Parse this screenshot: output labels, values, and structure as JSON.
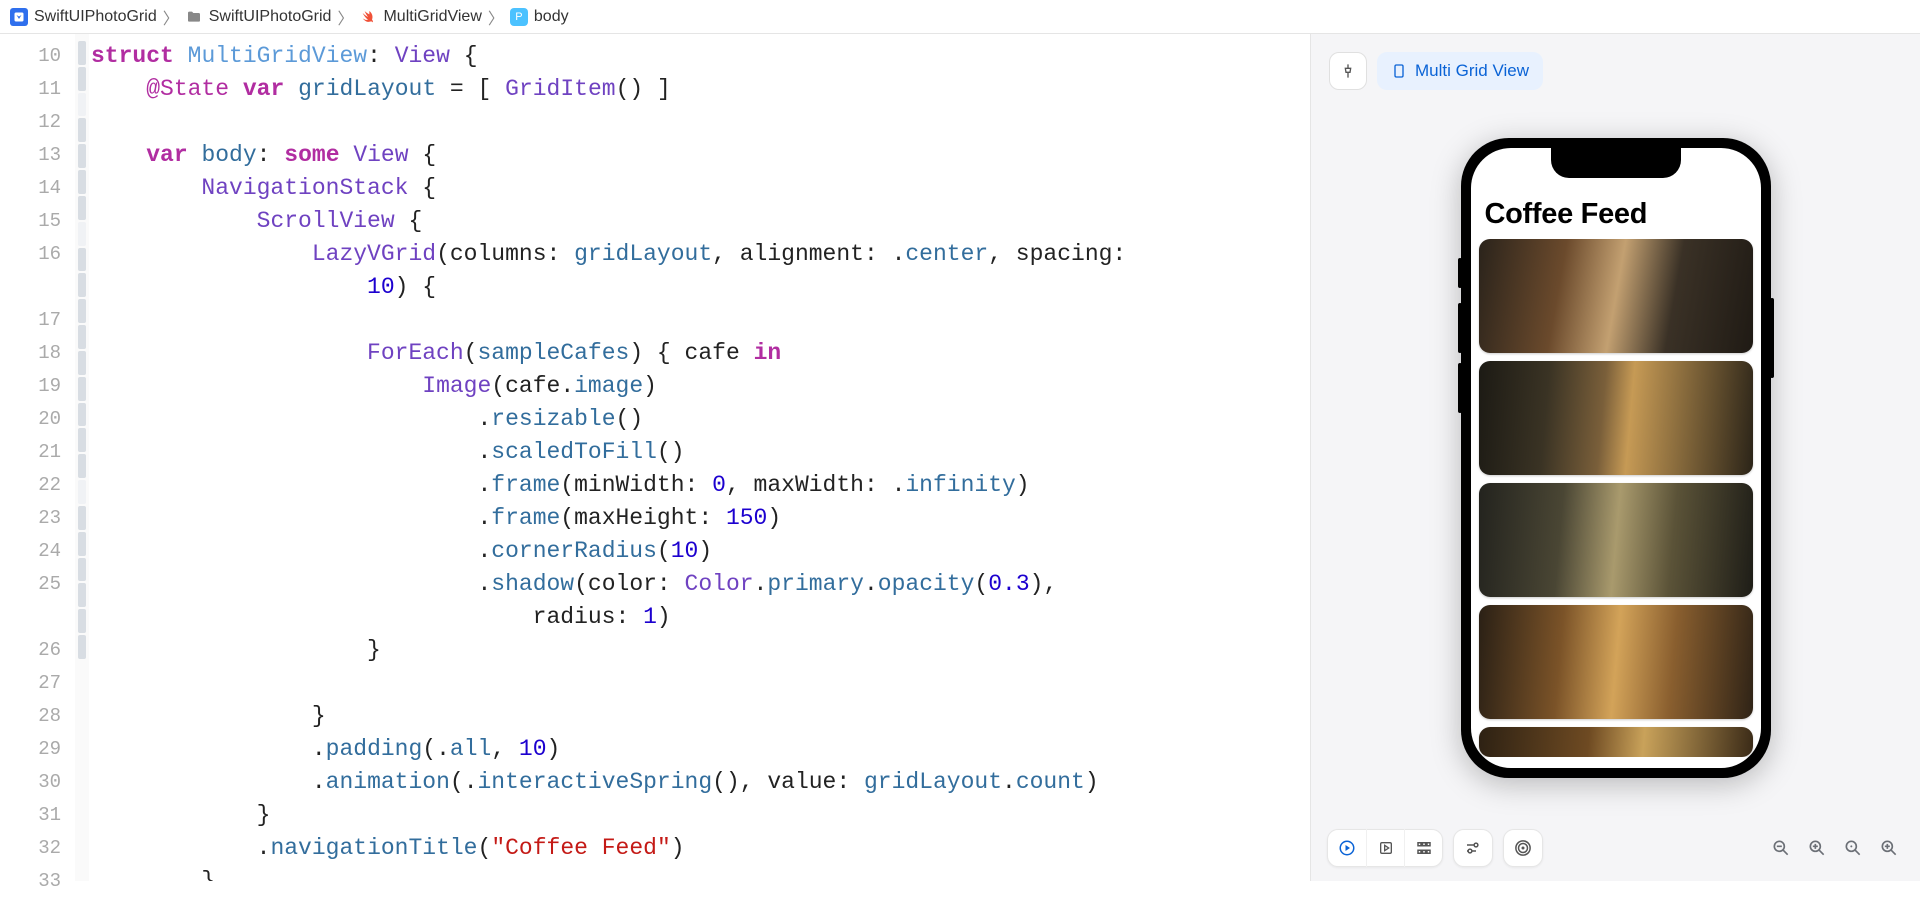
{
  "breadcrumb": {
    "project": "SwiftUIPhotoGrid",
    "folder": "SwiftUIPhotoGrid",
    "file": "MultiGridView",
    "symbol": "body"
  },
  "gutter": {
    "start": 10,
    "end": 33
  },
  "code": {
    "l10": {
      "kw_struct": "struct",
      "name": "MultiGridView",
      "colon": ":",
      "type": "View",
      "ob": "{"
    },
    "l11": {
      "at": "@State",
      "kw_var": "var",
      "name": "gridLayout",
      "eq": " = [ ",
      "item": "GridItem",
      "tail": "() ]"
    },
    "l13": {
      "kw_var": "var",
      "name": "body",
      "colon": ":",
      "some": "some",
      "type": "View",
      "ob": "{"
    },
    "l14": {
      "view": "NavigationStack",
      "ob": " {"
    },
    "l15": {
      "view": "ScrollView",
      "ob": " {"
    },
    "l16": {
      "view": "LazyVGrid",
      "op": "(columns: ",
      "arg1": "gridLayout",
      "mid": ", alignment: .",
      "align": "center",
      "mid2": ", spacing:"
    },
    "l16b": {
      "num": "10",
      "cb": ") {"
    },
    "l18": {
      "fe": "ForEach",
      "op": "(",
      "arg": "sampleCafes",
      "cl": ") { ",
      "id": "cafe",
      "kw": "in"
    },
    "l19": {
      "img": "Image",
      "op": "(",
      "base": "cafe",
      "dot": ".",
      "prop": "image",
      "cl": ")"
    },
    "l20": {
      "dot": ".",
      "m": "resizable",
      "p": "()"
    },
    "l21": {
      "dot": ".",
      "m": "scaledToFill",
      "p": "()"
    },
    "l22": {
      "dot": ".",
      "m": "frame",
      "op": "(minWidth: ",
      "n1": "0",
      "mid": ", maxWidth: .",
      "inf": "infinity",
      "cl": ")"
    },
    "l23": {
      "dot": ".",
      "m": "frame",
      "op": "(maxHeight: ",
      "n": "150",
      "cl": ")"
    },
    "l24": {
      "dot": ".",
      "m": "cornerRadius",
      "op": "(",
      "n": "10",
      "cl": ")"
    },
    "l25": {
      "dot": ".",
      "m": "shadow",
      "op": "(color: ",
      "t": "Color",
      "d1": ".",
      "p1": "primary",
      "d2": ".",
      "p2": "opacity",
      "op2": "(",
      "n": "0.3",
      "cl": "),"
    },
    "l25b": {
      "lbl": "radius",
      "colon": ": ",
      "n": "1",
      "cl": ")"
    },
    "l26": {
      "cb": "}"
    },
    "l28": {
      "cb": "}"
    },
    "l29": {
      "dot": ".",
      "m": "padding",
      "op": "(.",
      "a": "all",
      "mid": ", ",
      "n": "10",
      "cl": ")"
    },
    "l30": {
      "dot": ".",
      "m": "animation",
      "op": "(.",
      "a": "interactiveSpring",
      "p": "(), value: ",
      "g": "gridLayout",
      "d": ".",
      "c": "count",
      "cl": ")"
    },
    "l31": {
      "cb": "}"
    },
    "l32": {
      "dot": ".",
      "m": "navigationTitle",
      "op": "(",
      "s": "\"Coffee Feed\"",
      "cl": ")"
    },
    "l33": {
      "cb": "}"
    }
  },
  "preview": {
    "chip_label": "Multi Grid View",
    "nav_title": "Coffee Feed"
  }
}
